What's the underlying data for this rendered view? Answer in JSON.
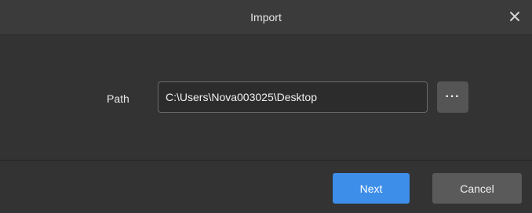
{
  "window": {
    "title": "Import",
    "close_icon": "close-icon"
  },
  "form": {
    "path_label": "Path",
    "path_value": "C:\\Users\\Nova003025\\Desktop",
    "browse_label": "···",
    "browse_icon": "more-icon"
  },
  "footer": {
    "next_label": "Next",
    "cancel_label": "Cancel"
  },
  "colors": {
    "primary": "#3d8ee9",
    "background": "#333333",
    "secondary_button": "#5a5a5a"
  }
}
